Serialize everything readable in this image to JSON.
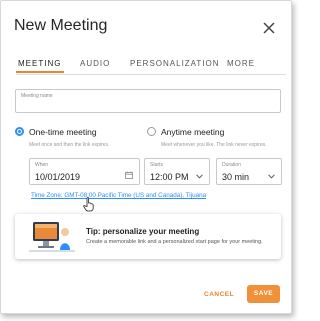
{
  "dialog": {
    "title": "New Meeting"
  },
  "tabs": [
    {
      "label": "MEETING",
      "active": true
    },
    {
      "label": "AUDIO",
      "active": false
    },
    {
      "label": "PERSONALIZATION",
      "active": false
    },
    {
      "label": "MORE",
      "active": false
    }
  ],
  "meeting_name": {
    "placeholder": "Meeting name",
    "value": ""
  },
  "meeting_type": {
    "one_time": {
      "title": "One-time meeting",
      "description": "Meet once and then the link expires.",
      "selected": true
    },
    "anytime": {
      "title": "Anytime meeting",
      "description": "Meet whenever you like. The link never expires.",
      "selected": false
    }
  },
  "when": {
    "label": "When",
    "value": "10/01/2019"
  },
  "starts": {
    "label": "Starts",
    "value": "12:00 PM"
  },
  "duration": {
    "label": "Duration",
    "value": "30 min"
  },
  "timezone": {
    "text": "Time Zone: GMT-08:00 Pacific Time (US and Canada), Tijuana"
  },
  "tip": {
    "title": "Tip: personalize your meeting",
    "description": "Create a memorable link and a personalized start page for your meeting."
  },
  "footer": {
    "cancel_label": "CANCEL",
    "save_label": "SAVE"
  },
  "colors": {
    "accent": "#e8852f",
    "link": "#2d8cff",
    "save_bg": "#f0913a"
  }
}
